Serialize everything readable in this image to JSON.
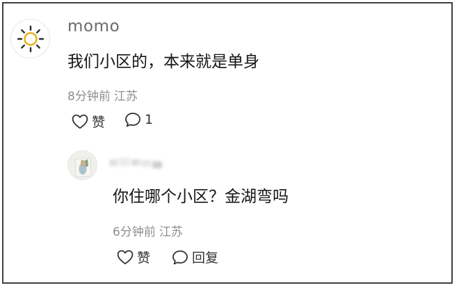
{
  "comment": {
    "username": "momo",
    "avatar_icon": "sun-icon",
    "text": "我们小区的，本来就是单身",
    "time": "8分钟前",
    "location": "江苏",
    "like_label": "赞",
    "reply_count": "1"
  },
  "reply": {
    "avatar_icon": "user-photo-icon",
    "text": "你住哪个小区？金湖弯吗",
    "time": "6分钟前",
    "location": "江苏",
    "like_label": "赞",
    "reply_label": "回复"
  },
  "colors": {
    "text_primary": "#161616",
    "text_secondary": "#8e8e8e",
    "username": "#6b6b6b",
    "frame_border": "#3f3f3f",
    "sun_icon": "#e8b21e"
  }
}
